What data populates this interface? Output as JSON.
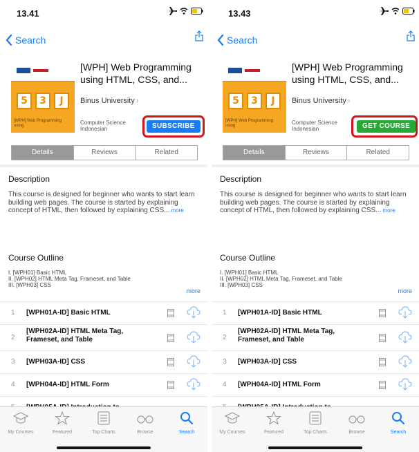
{
  "colors": {
    "accent": "#1a7cf5",
    "subscribe": "#1a7cf5",
    "get_course": "#27a936",
    "highlight_ring": "#d3131a",
    "cover": "#f5a623"
  },
  "panels": [
    {
      "status_time": "13.41",
      "cta_label": "SUBSCRIBE",
      "cta_color": "blue"
    },
    {
      "status_time": "13.43",
      "cta_label": "GET COURSE",
      "cta_color": "green"
    }
  ],
  "nav": {
    "back_label": "Search",
    "back_icon": "chevron-left-icon",
    "share_icon": "share-icon"
  },
  "course": {
    "title": "[WPH] Web Programming using HTML, CSS, and...",
    "provider": "Binus University",
    "category_line1": "Computer Science",
    "category_line2": "Indonesian",
    "cover_caption": "[WPH] Web Programming using"
  },
  "tabs_segment": [
    "Details",
    "Reviews",
    "Related"
  ],
  "description": {
    "heading": "Description",
    "text": "This course is designed for beginner who wants to start learn building web pages. The course is started by explaining concept of HTML, then followed by explaining CSS...",
    "more_label": "more"
  },
  "outline": {
    "heading": "Course Outline",
    "lines": [
      "I. [WPH01] Basic HTML",
      "II. [WPH02] HTML Meta Tag, Frameset, and Table",
      "III. [WPH03] CSS"
    ],
    "more_label": "more"
  },
  "lessons": [
    {
      "num": "1",
      "title": "[WPH01A-ID] Basic HTML"
    },
    {
      "num": "2",
      "title": "[WPH02A-ID] HTML Meta Tag, Frameset, and Table"
    },
    {
      "num": "3",
      "title": "[WPH03A-ID] CSS"
    },
    {
      "num": "4",
      "title": "[WPH04A-ID] HTML Form"
    },
    {
      "num": "5",
      "title": "[WPH05A-ID] Introduction to"
    }
  ],
  "tab_bar": [
    {
      "label": "My Courses",
      "icon": "graduation-cap-icon"
    },
    {
      "label": "Featured",
      "icon": "star-icon"
    },
    {
      "label": "Top Charts",
      "icon": "list-icon"
    },
    {
      "label": "Browse",
      "icon": "glasses-icon"
    },
    {
      "label": "Search",
      "icon": "search-icon",
      "active": true
    }
  ]
}
